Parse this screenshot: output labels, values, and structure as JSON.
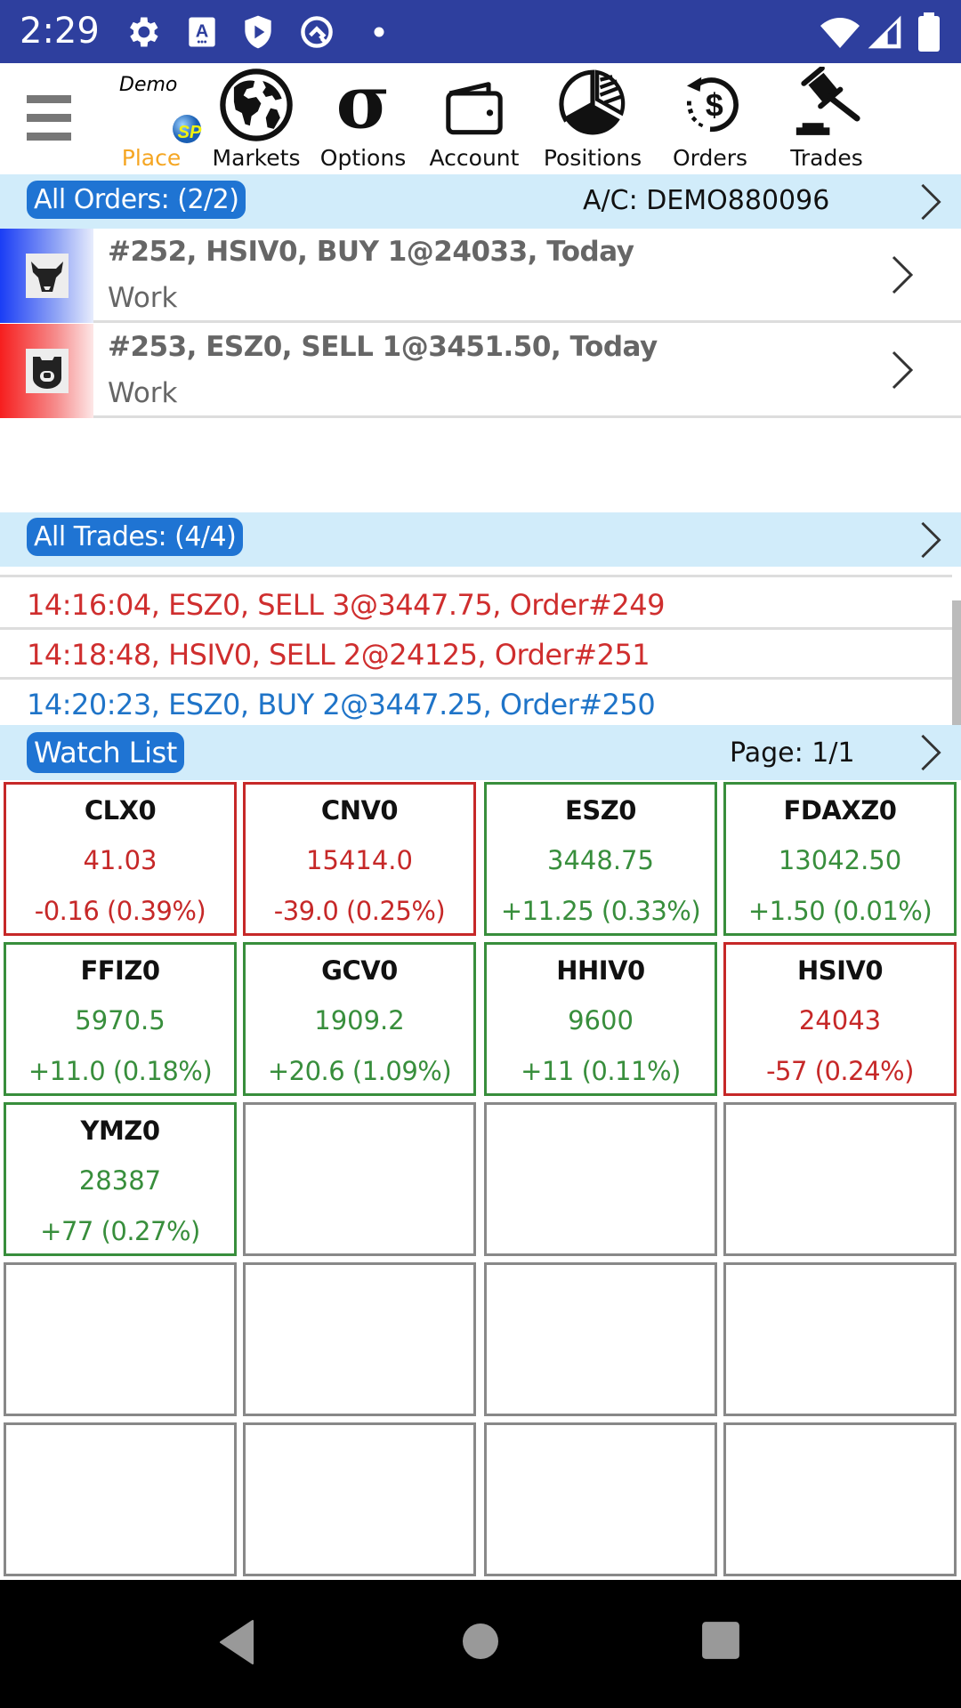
{
  "status_bar": {
    "time": "2:29",
    "icons": [
      "gear-icon",
      "accessibility-icon",
      "shield-play-icon",
      "q-icon",
      "dot-icon",
      "wifi-icon",
      "signal-icon",
      "battery-icon"
    ]
  },
  "toolbar": {
    "mode": "Demo",
    "logo": "SP",
    "items": [
      {
        "label": "Place",
        "icon": "sp-logo-icon",
        "active": true
      },
      {
        "label": "Markets",
        "icon": "globe-icon"
      },
      {
        "label": "Options",
        "icon": "sigma-icon"
      },
      {
        "label": "Account",
        "icon": "wallet-icon"
      },
      {
        "label": "Positions",
        "icon": "pie-chart-icon"
      },
      {
        "label": "Orders",
        "icon": "dollar-history-icon"
      },
      {
        "label": "Trades",
        "icon": "gavel-icon"
      }
    ],
    "active_color": "#f5a623"
  },
  "orders": {
    "header": "All Orders: (2/2)",
    "account": "A/C: DEMO880096",
    "rows": [
      {
        "side": "buy",
        "icon": "bull-icon",
        "line1": "#252, HSIV0, BUY 1@24033, Today",
        "line2": "Work"
      },
      {
        "side": "sell",
        "icon": "bear-icon",
        "line1": "#253, ESZ0, SELL 1@3451.50, Today",
        "line2": "Work"
      }
    ]
  },
  "trades": {
    "header": "All Trades: (4/4)",
    "rows": [
      {
        "side": "buy",
        "text": ""
      },
      {
        "side": "sell",
        "text": "14:16:04, ESZ0, SELL 3@3447.75, Order#249"
      },
      {
        "side": "sell",
        "text": "14:18:48, HSIV0, SELL 2@24125, Order#251"
      },
      {
        "side": "buy",
        "text": "14:20:23, ESZ0, BUY 2@3447.25, Order#250"
      }
    ]
  },
  "watchlist": {
    "header": "Watch List",
    "page": "Page: 1/1",
    "cells": [
      {
        "symbol": "CLX0",
        "price": "41.03",
        "change": "-0.16 (0.39%)",
        "dir": "down"
      },
      {
        "symbol": "CNV0",
        "price": "15414.0",
        "change": "-39.0 (0.25%)",
        "dir": "down"
      },
      {
        "symbol": "ESZ0",
        "price": "3448.75",
        "change": "+11.25 (0.33%)",
        "dir": "up"
      },
      {
        "symbol": "FDAXZ0",
        "price": "13042.50",
        "change": "+1.50 (0.01%)",
        "dir": "up"
      },
      {
        "symbol": "FFIZ0",
        "price": "5970.5",
        "change": "+11.0 (0.18%)",
        "dir": "up"
      },
      {
        "symbol": "GCV0",
        "price": "1909.2",
        "change": "+20.6 (1.09%)",
        "dir": "up"
      },
      {
        "symbol": "HHIV0",
        "price": "9600",
        "change": "+11 (0.11%)",
        "dir": "up"
      },
      {
        "symbol": "HSIV0",
        "price": "24043",
        "change": "-57 (0.24%)",
        "dir": "down"
      },
      {
        "symbol": "YMZ0",
        "price": "28387",
        "change": "+77 (0.27%)",
        "dir": "up"
      },
      {
        "symbol": "",
        "price": "",
        "change": "",
        "dir": "empty"
      },
      {
        "symbol": "",
        "price": "",
        "change": "",
        "dir": "empty"
      },
      {
        "symbol": "",
        "price": "",
        "change": "",
        "dir": "empty"
      },
      {
        "symbol": "",
        "price": "",
        "change": "",
        "dir": "empty"
      },
      {
        "symbol": "",
        "price": "",
        "change": "",
        "dir": "empty"
      },
      {
        "symbol": "",
        "price": "",
        "change": "",
        "dir": "empty"
      },
      {
        "symbol": "",
        "price": "",
        "change": "",
        "dir": "empty"
      },
      {
        "symbol": "",
        "price": "",
        "change": "",
        "dir": "empty"
      },
      {
        "symbol": "",
        "price": "",
        "change": "",
        "dir": "empty"
      },
      {
        "symbol": "",
        "price": "",
        "change": "",
        "dir": "empty"
      },
      {
        "symbol": "",
        "price": "",
        "change": "",
        "dir": "empty"
      }
    ]
  },
  "nav_bar": {
    "buttons": [
      "back-icon",
      "home-icon",
      "recents-icon"
    ]
  }
}
